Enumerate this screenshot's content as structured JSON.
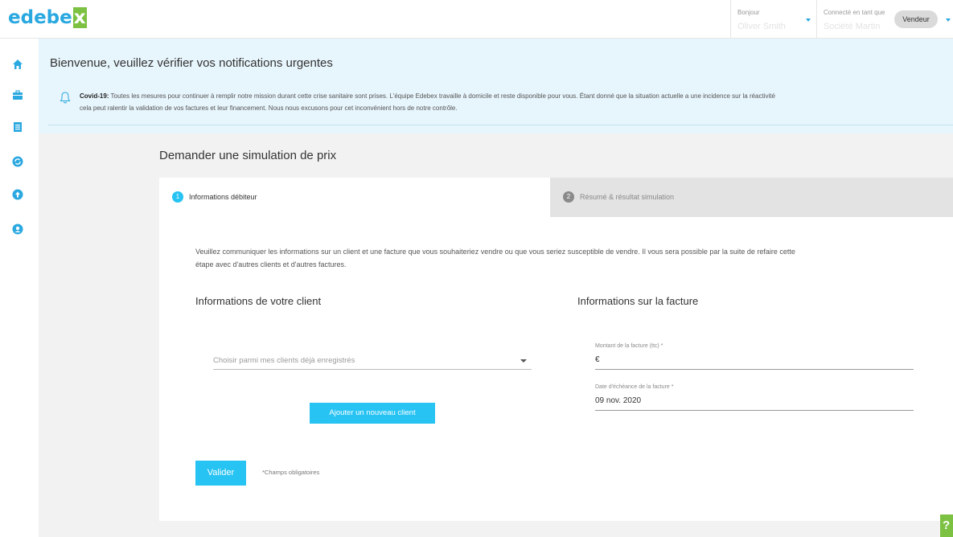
{
  "header": {
    "logo_text": "edebe",
    "logo_x": "x",
    "greeting_label": "Bonjour",
    "greeting_name": "Oliver Smith",
    "connected_label": "Connecté en tant que",
    "connected_name": "Société Martin",
    "role_label": "Vendeur"
  },
  "sidebar": {
    "icons": [
      "home-icon",
      "briefcase-icon",
      "list-icon",
      "refresh-icon",
      "upload-icon",
      "support-icon"
    ]
  },
  "banner": {
    "title": "Bienvenue, veuillez vérifier vos notifications urgentes",
    "covid_label": "Covid-19:",
    "covid_text_1": " Toutes les mesures pour continuer à remplir notre mission durant cette crise sanitaire sont prises. L'équipe Edebex travaille à domicile et reste disponible pour vous. Étant donné que la situation actuelle a une incidence sur la réactivité",
    "covid_text_2": "cela peut ralentir la validation de vos factures et leur financement. Nous nous excusons pour cet inconvénient hors de notre contrôle."
  },
  "main": {
    "title": "Demander une simulation de prix",
    "steps": [
      {
        "number": "1",
        "label": "Informations débiteur"
      },
      {
        "number": "2",
        "label": "Résumé & résultat simulation"
      }
    ],
    "intro_1": "Veuillez communiquer les informations sur un client et une facture que vous souhaiteriez vendre ou que vous seriez susceptible de vendre. Il vous sera possible par la suite de refaire cette",
    "intro_2": "étape avec d'autres clients et d'autres factures.",
    "client_section_title": "Informations de votre client",
    "invoice_section_title": "Informations sur la facture",
    "client_select_placeholder": "Choisir parmi mes clients déjà enregistrés",
    "add_client_label": "Ajouter un nouveau client",
    "amount_label": "Montant de la facture (ttc) *",
    "amount_value": "€",
    "due_date_label": "Date d'échéance de la facture *",
    "due_date_value": "09 nov. 2020",
    "validate_label": "Valider",
    "required_note": "*Champs obligatoires"
  },
  "help": {
    "label": "?"
  },
  "colors": {
    "accent": "#2aa8e0",
    "button": "#27c3f3",
    "brand_green": "#7cc142",
    "banner_bg": "#e7f5fc"
  }
}
